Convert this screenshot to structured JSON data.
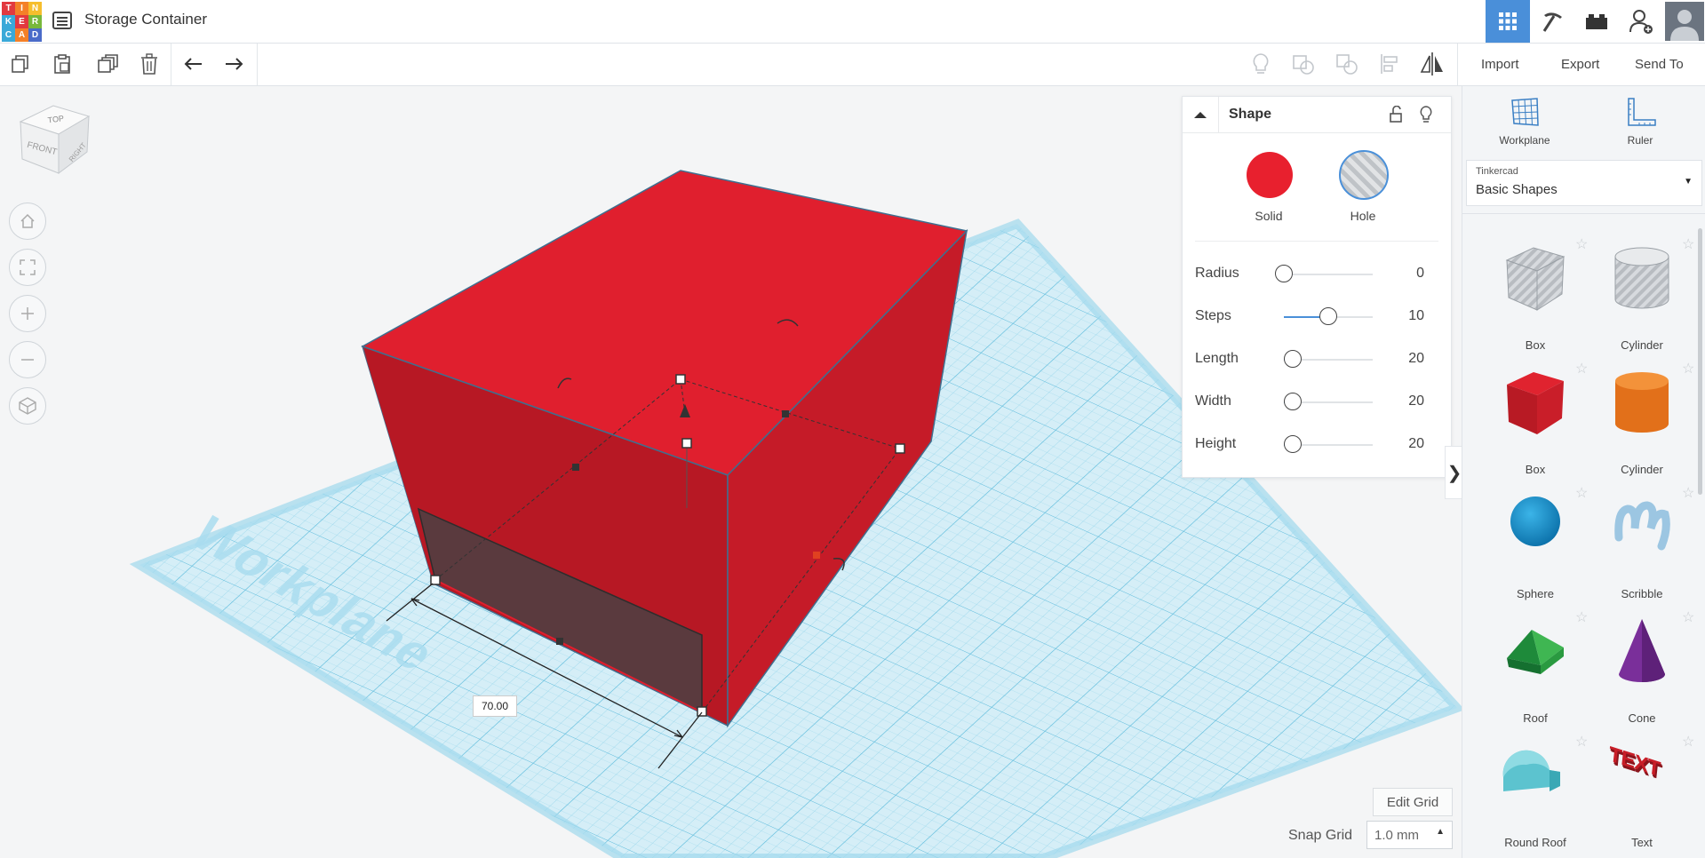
{
  "app": {
    "logo_letters": [
      "T",
      "I",
      "N",
      "K",
      "E",
      "R",
      "C",
      "A",
      "D"
    ],
    "logo_colors": [
      "#e2393f",
      "#f48028",
      "#f6be2d",
      "#3aa9d8",
      "#e2393f",
      "#78b83b",
      "#3aa9d8",
      "#f48028",
      "#4a6bc9"
    ],
    "title": "Storage Container"
  },
  "header": {
    "right_icons": [
      "grid-view-icon",
      "build-pickaxe-icon",
      "bricks-icon",
      "add-user-icon",
      "avatar"
    ],
    "accent": "#4a8fd9"
  },
  "toolbar": {
    "left_icons": [
      "copy-icon",
      "paste-icon",
      "duplicate-icon",
      "delete-icon",
      "undo-icon",
      "redo-icon"
    ],
    "right_icons": [
      "bulb-icon",
      "group-icon",
      "ungroup-icon",
      "align-icon",
      "mirror-icon"
    ],
    "import_label": "Import",
    "export_label": "Export",
    "send_label": "Send To"
  },
  "viewcube": {
    "top": "TOP",
    "front": "FRONT",
    "right": "RIGHT"
  },
  "nav_controls": [
    "home-icon",
    "fit-icon",
    "zoom-in-icon",
    "zoom-out-icon",
    "perspective-icon"
  ],
  "scene": {
    "workplane_label": "Workplane",
    "dimension": "70.00",
    "box_color": "#e01f2e",
    "hole_color": "#5a3a3e",
    "grid_color": "#8fd3ea"
  },
  "inspector": {
    "title": "Shape",
    "solid_label": "Solid",
    "hole_label": "Hole",
    "solid_color": "#e8202e",
    "props": [
      {
        "label": "Radius",
        "value": "0",
        "level": 0.0
      },
      {
        "label": "Steps",
        "value": "10",
        "level": 0.5
      },
      {
        "label": "Length",
        "value": "20",
        "level": 0.1
      },
      {
        "label": "Width",
        "value": "20",
        "level": 0.1
      },
      {
        "label": "Height",
        "value": "20",
        "level": 0.1
      }
    ]
  },
  "panel": {
    "workplane_label": "Workplane",
    "ruler_label": "Ruler",
    "library_owner": "Tinkercad",
    "library_name": "Basic Shapes",
    "shapes": [
      {
        "label": "Box",
        "icon": "box-hole-icon"
      },
      {
        "label": "Cylinder",
        "icon": "cylinder-hole-icon"
      },
      {
        "label": "Box",
        "icon": "box-icon"
      },
      {
        "label": "Cylinder",
        "icon": "cylinder-icon"
      },
      {
        "label": "Sphere",
        "icon": "sphere-icon"
      },
      {
        "label": "Scribble",
        "icon": "scribble-icon"
      },
      {
        "label": "Roof",
        "icon": "roof-icon"
      },
      {
        "label": "Cone",
        "icon": "cone-icon"
      },
      {
        "label": "Round Roof",
        "icon": "round-roof-icon"
      },
      {
        "label": "Text",
        "icon": "text-icon"
      }
    ]
  },
  "bottom": {
    "edit_grid_label": "Edit Grid",
    "snap_label": "Snap Grid",
    "snap_value": "1.0 mm"
  }
}
